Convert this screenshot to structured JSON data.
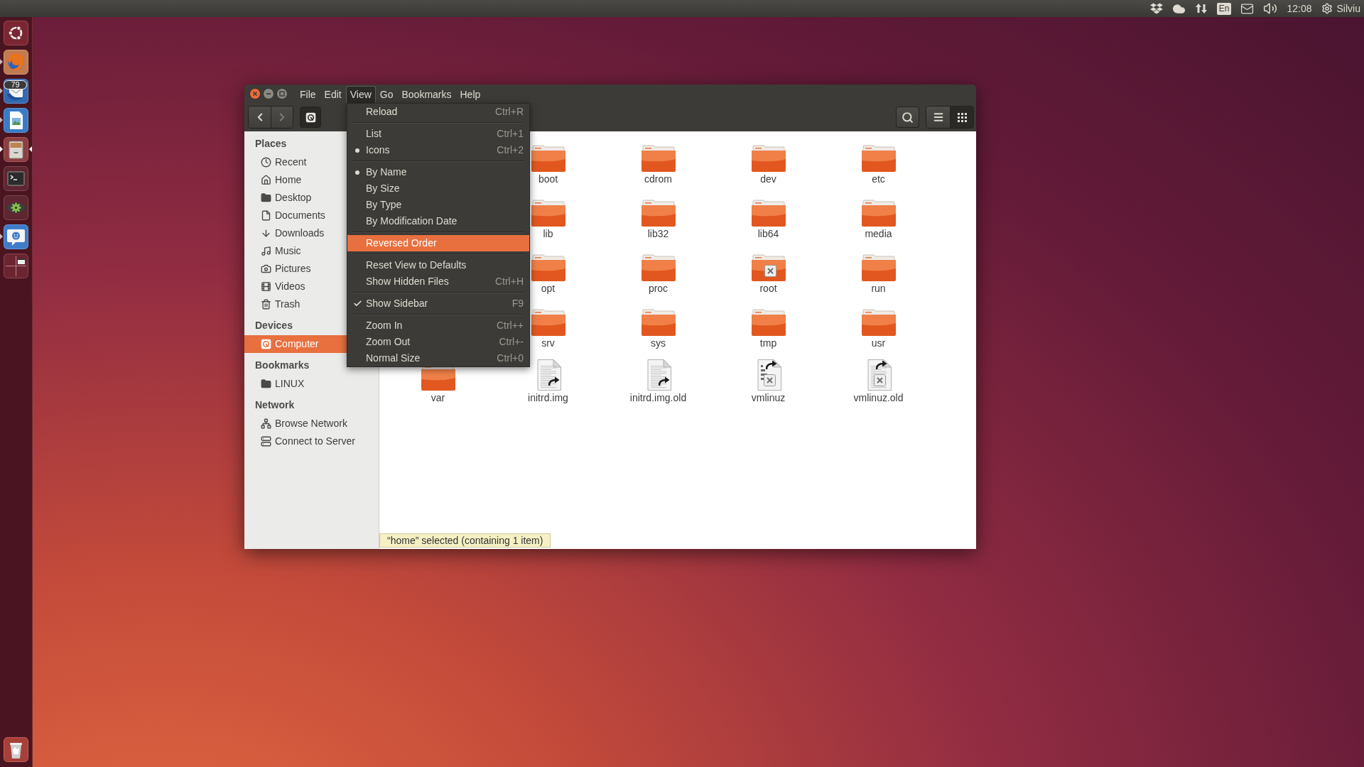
{
  "top_panel": {
    "keyboard_layout": "En",
    "clock": "12:08",
    "user": "Silviu"
  },
  "launcher": {
    "items": [
      {
        "running": false,
        "focused": false
      },
      {
        "running": true,
        "focused": false
      },
      {
        "running": true,
        "focused": false,
        "badge": "79"
      },
      {
        "running": true,
        "focused": false
      },
      {
        "running": true,
        "focused": true
      },
      {
        "running": false,
        "focused": false
      },
      {
        "running": false,
        "focused": false
      },
      {
        "running": true,
        "focused": false
      },
      {
        "running": false,
        "focused": false
      }
    ]
  },
  "window": {
    "menubar": [
      {
        "label": "File",
        "selected": false
      },
      {
        "label": "Edit",
        "selected": false
      },
      {
        "label": "View",
        "selected": true
      },
      {
        "label": "Go",
        "selected": false
      },
      {
        "label": "Bookmarks",
        "selected": false
      },
      {
        "label": "Help",
        "selected": false
      }
    ],
    "view_menu": {
      "groups": [
        [
          {
            "label": "Reload",
            "shortcut": "Ctrl+R",
            "kind": "action",
            "selected": false
          }
        ],
        [
          {
            "label": "List",
            "shortcut": "Ctrl+1",
            "kind": "radio",
            "checked": false,
            "selected": false
          },
          {
            "label": "Icons",
            "shortcut": "Ctrl+2",
            "kind": "radio",
            "checked": true,
            "selected": false
          }
        ],
        [
          {
            "label": "By Name",
            "kind": "radio",
            "checked": true,
            "selected": false
          },
          {
            "label": "By Size",
            "kind": "radio",
            "checked": false,
            "selected": false
          },
          {
            "label": "By Type",
            "kind": "radio",
            "checked": false,
            "selected": false
          },
          {
            "label": "By Modification Date",
            "kind": "radio",
            "checked": false,
            "selected": false
          }
        ],
        [
          {
            "label": "Reversed Order",
            "kind": "check",
            "checked": false,
            "selected": true
          }
        ],
        [
          {
            "label": "Reset View to Defaults",
            "kind": "action",
            "selected": false
          },
          {
            "label": "Show Hidden Files",
            "shortcut": "Ctrl+H",
            "kind": "check",
            "checked": false,
            "selected": false
          }
        ],
        [
          {
            "label": "Show Sidebar",
            "shortcut": "F9",
            "kind": "check",
            "checked": true,
            "selected": false
          }
        ],
        [
          {
            "label": "Zoom In",
            "shortcut": "Ctrl++",
            "kind": "action",
            "selected": false
          },
          {
            "label": "Zoom Out",
            "shortcut": "Ctrl+-",
            "kind": "action",
            "selected": false
          },
          {
            "label": "Normal Size",
            "shortcut": "Ctrl+0",
            "kind": "action",
            "selected": false
          }
        ]
      ]
    },
    "toolbar": {
      "back": {
        "disabled": false
      },
      "forward": {
        "disabled": true
      },
      "views": [
        {
          "selected": false
        },
        {
          "selected": true
        }
      ]
    },
    "sidebar": {
      "sections": [
        {
          "title": "Places",
          "items": [
            {
              "label": "Recent",
              "selected": false
            },
            {
              "label": "Home",
              "selected": false
            },
            {
              "label": "Desktop",
              "selected": false
            },
            {
              "label": "Documents",
              "selected": false
            },
            {
              "label": "Downloads",
              "selected": false
            },
            {
              "label": "Music",
              "selected": false
            },
            {
              "label": "Pictures",
              "selected": false
            },
            {
              "label": "Videos",
              "selected": false
            },
            {
              "label": "Trash",
              "selected": false
            }
          ]
        },
        {
          "title": "Devices",
          "items": [
            {
              "label": "Computer",
              "selected": true
            }
          ]
        },
        {
          "title": "Bookmarks",
          "items": [
            {
              "label": "LINUX",
              "selected": false
            }
          ]
        },
        {
          "title": "Network",
          "items": [
            {
              "label": "Browse Network",
              "selected": false
            },
            {
              "label": "Connect to Server",
              "selected": false
            }
          ]
        }
      ]
    },
    "file_rows": [
      [
        {
          "name": "boot",
          "kind": "folder",
          "link": false,
          "unreadable": false
        },
        {
          "name": "cdrom",
          "kind": "folder",
          "link": false,
          "unreadable": false
        },
        {
          "name": "dev",
          "kind": "folder",
          "link": false,
          "unreadable": false
        },
        {
          "name": "etc",
          "kind": "folder",
          "link": false,
          "unreadable": false
        }
      ],
      [
        {
          "name": "lib",
          "kind": "folder",
          "link": false,
          "unreadable": false
        },
        {
          "name": "lib32",
          "kind": "folder",
          "link": false,
          "unreadable": false
        },
        {
          "name": "lib64",
          "kind": "folder",
          "link": false,
          "unreadable": false
        },
        {
          "name": "media",
          "kind": "folder",
          "link": false,
          "unreadable": false
        }
      ],
      [
        {
          "name": "opt",
          "kind": "folder",
          "link": false,
          "unreadable": false
        },
        {
          "name": "proc",
          "kind": "folder",
          "link": false,
          "unreadable": false
        },
        {
          "name": "root",
          "kind": "folder",
          "link": false,
          "unreadable": true
        },
        {
          "name": "run",
          "kind": "folder",
          "link": false,
          "unreadable": false
        }
      ],
      [
        {
          "name": "srv",
          "kind": "folder",
          "link": false,
          "unreadable": false
        },
        {
          "name": "sys",
          "kind": "folder",
          "link": false,
          "unreadable": false
        },
        {
          "name": "tmp",
          "kind": "folder",
          "link": false,
          "unreadable": false
        },
        {
          "name": "usr",
          "kind": "folder",
          "link": false,
          "unreadable": false
        }
      ],
      [
        {
          "name": "var",
          "kind": "folder",
          "link": false,
          "unreadable": false
        },
        {
          "name": "initrd.img",
          "kind": "document",
          "link": true,
          "unreadable": false
        },
        {
          "name": "initrd.img.old",
          "kind": "document",
          "link": true,
          "unreadable": false
        },
        {
          "name": "vmlinuz",
          "kind": "binary",
          "link": true,
          "unreadable": true
        },
        {
          "name": "vmlinuz.old",
          "kind": "document",
          "link": true,
          "unreadable": true
        }
      ]
    ],
    "status_bar": {
      "text": "“home” selected (containing 1 item)"
    }
  }
}
